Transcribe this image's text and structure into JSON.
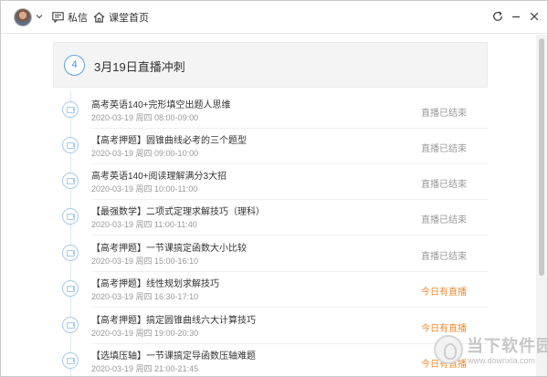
{
  "header": {
    "messages_label": "私信",
    "home_label": "课堂首页",
    "icons": [
      "avatar",
      "chevron-down-icon",
      "message-icon",
      "home-icon",
      "refresh-icon",
      "minimize-icon",
      "close-icon"
    ]
  },
  "section": {
    "number": "4",
    "title": "3月19日直播冲刺"
  },
  "lessons": [
    {
      "title": "高考英语140+完形填空出题人思维",
      "time": "2020-03-19 周四 08:00-09:00",
      "status": "直播已结束",
      "live": false
    },
    {
      "title": "【高考押题】圆锥曲线必考的三个题型",
      "time": "2020-03-19 周四 09:00-10:00",
      "status": "直播已结束",
      "live": false
    },
    {
      "title": "高考英语140+阅读理解满分3大招",
      "time": "2020-03-19 周四 10:00-11:00",
      "status": "直播已结束",
      "live": false
    },
    {
      "title": "【最强数学】二项式定理求解技巧（理科）",
      "time": "2020-03-19 周四 11:00-11:40",
      "status": "直播已结束",
      "live": false
    },
    {
      "title": "【高考押题】一节课搞定函数大小比较",
      "time": "2020-03-19 周四 15:00-16:10",
      "status": "直播已结束",
      "live": false
    },
    {
      "title": "【高考押题】线性规划求解技巧",
      "time": "2020-03-19 周四 16:30-17:10",
      "status": "今日有直播",
      "live": true
    },
    {
      "title": "【高考押题】搞定圆锥曲线六大计算技巧",
      "time": "2020-03-19 周四 19:00-20:30",
      "status": "今日有直播",
      "live": true
    },
    {
      "title": "【选填压轴】一节课搞定导函数压轴难题",
      "time": "2020-03-19 周四 21:00-21:45",
      "status": "今日有直播",
      "live": true
    }
  ],
  "watermark": {
    "text": "当下软件园",
    "url": "www.downxia.com"
  },
  "colors": {
    "accent": "#3c8de0",
    "live_status": "#f08a2b",
    "ended_status": "#999999"
  }
}
